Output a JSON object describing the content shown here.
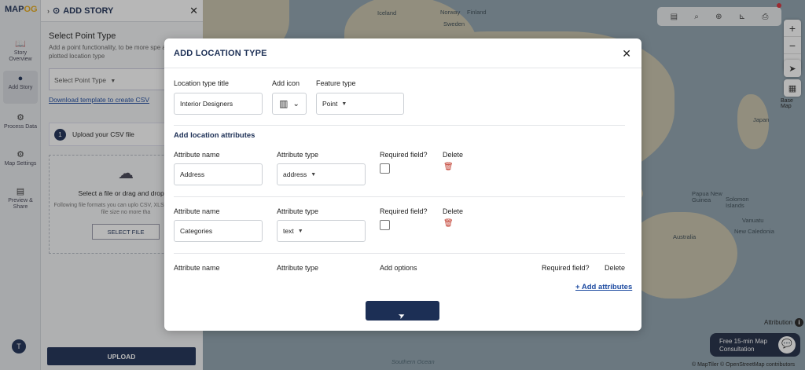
{
  "app": {
    "logo_text": "MAPOG",
    "story_panel_title": "ADD STORY"
  },
  "rail": {
    "items": [
      {
        "icon": "book-icon",
        "label": "Story Overview"
      },
      {
        "icon": "location-pin-icon",
        "label": "Add Story",
        "active": true
      },
      {
        "icon": "gear-icon",
        "label": "Process Data"
      },
      {
        "icon": "settings-icon",
        "label": "Map Settings"
      },
      {
        "icon": "preview-icon",
        "label": "Preview & Share"
      }
    ],
    "avatar_initial": "T"
  },
  "panel": {
    "point_type_title": "Select Point Type",
    "point_type_desc": "Add a point functionality, to be more spe about the plotted location type",
    "point_type_placeholder": "Select Point Type",
    "download_link": "Download template to create CSV",
    "step_number": "1",
    "step_label": "Upload your CSV file",
    "dropzone_title": "Select a file or drag and drop he",
    "dropzone_sub": "Following file formats you can uplo CSV, XLSX, XLS, ODS, file size no more tha",
    "select_file_label": "SELECT FILE",
    "upload_label": "UPLOAD"
  },
  "map": {
    "labels": [
      {
        "text": "Iceland"
      },
      {
        "text": "Norway"
      },
      {
        "text": "Finland"
      },
      {
        "text": "Sweden"
      },
      {
        "text": "Japan"
      },
      {
        "text": "Papua New Guinea"
      },
      {
        "text": "Solomon Islands"
      },
      {
        "text": "Vanuatu"
      },
      {
        "text": "New Caledonia"
      },
      {
        "text": "Australia"
      },
      {
        "text": "Southern Ocean"
      }
    ],
    "basemap_label": "Base Map",
    "attribution_label": "Attribution",
    "consult_label": "Free 15-min Map Consultation",
    "copyright": "© MapTiler © OpenStreetMap contributors"
  },
  "modal": {
    "title": "ADD LOCATION TYPE",
    "location_type_title_label": "Location type title",
    "location_type_title_value": "Interior Designers",
    "add_icon_label": "Add icon",
    "feature_type_label": "Feature type",
    "feature_type_value": "Point",
    "attributes_section_title": "Add location attributes",
    "attributes": [
      {
        "name_label": "Attribute name",
        "name_value": "Address",
        "type_label": "Attribute type",
        "type_value": "address",
        "required_label": "Required field?",
        "delete_label": "Delete"
      },
      {
        "name_label": "Attribute name",
        "name_value": "Categories",
        "type_label": "Attribute type",
        "type_value": "text",
        "required_label": "Required field?",
        "delete_label": "Delete"
      }
    ],
    "third_row": {
      "name_label": "Attribute name",
      "type_label": "Attribute type",
      "options_label": "Add options",
      "required_label": "Required field?",
      "delete_label": "Delete"
    },
    "add_attributes_link": "+ Add attributes",
    "save_button_label": ""
  },
  "colors": {
    "brand_navy": "#1c2f55",
    "link_blue": "#1c4aa0",
    "delete_red": "#c0392b"
  }
}
